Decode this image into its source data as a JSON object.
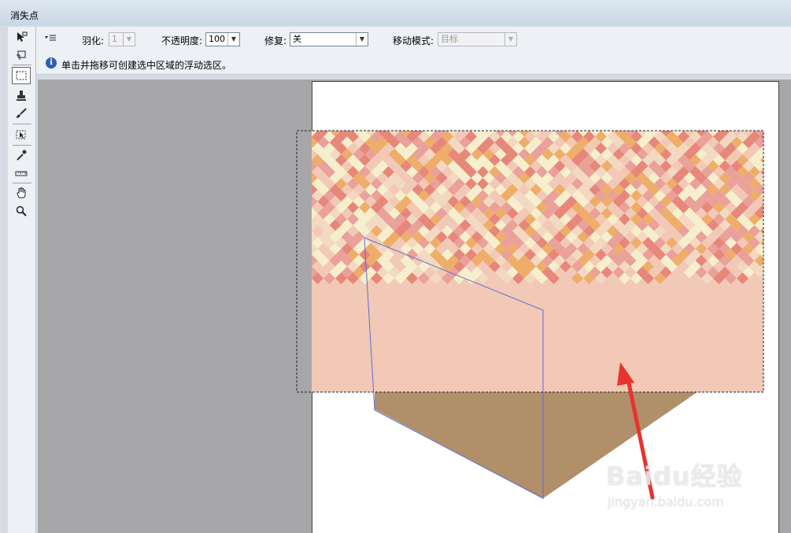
{
  "window": {
    "title": "消失点"
  },
  "options": {
    "menu_icon": "flyout-menu-icon",
    "feather_label": "羽化:",
    "feather_value": "1",
    "opacity_label": "不透明度:",
    "opacity_value": "100",
    "heal_label": "修复:",
    "heal_value": "关",
    "move_mode_label": "移动模式:",
    "move_mode_value": "目标"
  },
  "hint": {
    "icon": "info-icon",
    "text": "单击并拖移可创建选中区域的浮动选区。"
  },
  "tools": [
    {
      "name": "edit-plane-tool",
      "icon": "arrow-plane-icon"
    },
    {
      "name": "create-plane-tool",
      "icon": "create-plane-icon"
    },
    {
      "name": "marquee-tool",
      "icon": "marquee-icon",
      "active": true
    },
    {
      "name": "stamp-tool",
      "icon": "stamp-icon"
    },
    {
      "name": "brush-tool",
      "icon": "brush-icon"
    },
    {
      "name": "transform-tool",
      "icon": "transform-icon"
    },
    {
      "name": "eyedropper-tool",
      "icon": "eyedropper-icon"
    },
    {
      "name": "measure-tool",
      "icon": "ruler-icon"
    },
    {
      "name": "hand-tool",
      "icon": "hand-icon"
    },
    {
      "name": "zoom-tool",
      "icon": "zoom-icon"
    }
  ],
  "watermark": {
    "brand": "Baidu经验",
    "url": "jingyan.baidu.com"
  },
  "colors": {
    "tile_palette": [
      "#f6efcd",
      "#f2c9b7",
      "#e7877a",
      "#eeae6a",
      "#e9a19a",
      "#f3d9c1"
    ],
    "cardboard": "#b08f69",
    "plane_line": "#5a6ed6",
    "arrow": "#e8342e"
  }
}
